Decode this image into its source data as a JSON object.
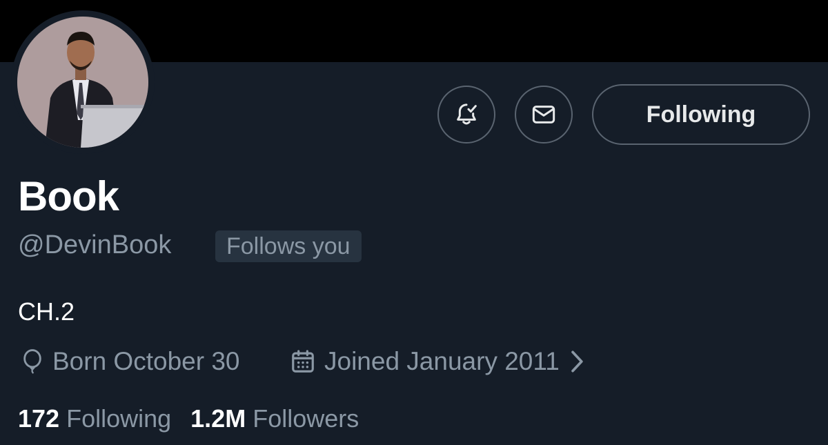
{
  "profile": {
    "display_name": "Book",
    "handle": "@DevinBook",
    "follows_you_badge": "Follows you",
    "bio": "CH.2",
    "avatar_icon": "profile-photo"
  },
  "actions": {
    "notify_icon": "bell-check-icon",
    "message_icon": "envelope-icon",
    "follow_label": "Following"
  },
  "meta": {
    "born": "Born October 30",
    "born_icon": "balloon-icon",
    "joined": "Joined January 2011",
    "joined_icon": "calendar-icon",
    "expand_icon": "chevron-right-icon"
  },
  "stats": {
    "following_count": "172",
    "following_label": "Following",
    "followers_count": "1.2M",
    "followers_label": "Followers"
  },
  "colors": {
    "background": "#151d28",
    "banner": "#000000",
    "text_primary": "#ffffff",
    "text_secondary": "#8b98a5",
    "border": "#5a6470",
    "badge_bg": "#273340"
  }
}
